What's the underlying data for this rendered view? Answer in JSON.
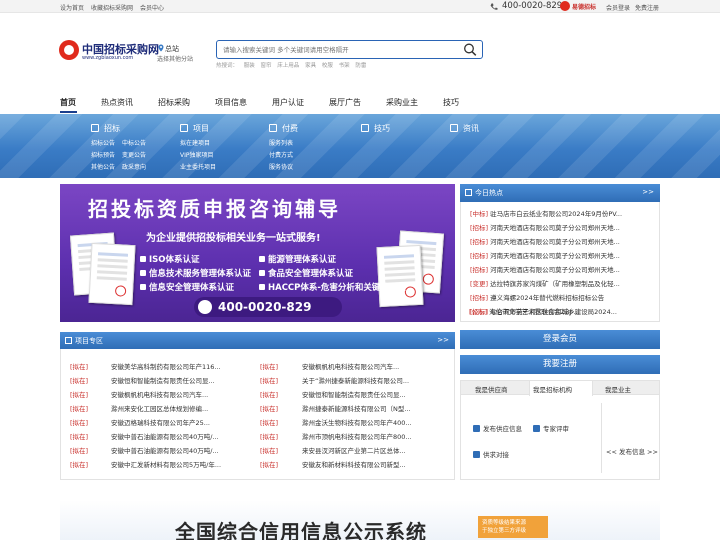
{
  "topbar": {
    "links": [
      "设为首页",
      "收藏招标采购网",
      "会员中心"
    ],
    "phone": "400-0020-829",
    "brand": "易德招标",
    "member_login": "会员登录",
    "free_register": "免费注册"
  },
  "header": {
    "logo_text": "中国招标采购网",
    "logo_url": "www.zgbiaoxun.com",
    "site_name": "总站",
    "site_switch": "选择其他分站",
    "search_placeholder": "请输入搜索关键词 多个关键词请用空格隔开",
    "hot_label": "热搜词：",
    "hot_words": [
      "服装",
      "窗帘",
      "床上用品",
      "家具",
      "校服",
      "书架",
      "防雷"
    ]
  },
  "nav": [
    "首页",
    "热点资讯",
    "招标采购",
    "项目信息",
    "用户认证",
    "展厅广告",
    "采购业主",
    "技巧"
  ],
  "band": [
    {
      "title": "招标",
      "links": [
        "招标公告",
        "中标公告",
        "招标预告",
        "变更公告",
        "其他公告",
        "政采意向"
      ]
    },
    {
      "title": "项目",
      "links": [
        "拟在建项目",
        "VIP独家项目",
        "业主委托项目"
      ]
    },
    {
      "title": "付费",
      "links": [
        "服务列表",
        "付费方式",
        "服务协议"
      ]
    },
    {
      "title": "技巧",
      "links": []
    },
    {
      "title": "资讯",
      "links": []
    }
  ],
  "banner": {
    "title": "招投标资质申报咨询辅导",
    "subtitle": "为企业提供招投标相关业务一站式服务!",
    "items": [
      "ISO体系认证",
      "能源管理体系认证",
      "信息技术服务管理体系认证",
      "食品安全管理体系认证",
      "信息安全管理体系认证",
      "HACCP体系-危害分析和关键控制点"
    ],
    "phone": "400-0020-829"
  },
  "hot_panel": {
    "title": "今日热点",
    "more": ">>",
    "rows": [
      {
        "tag": "[中标]",
        "text": "驻马店市白云纸业有限公司2024年9月份PV..."
      },
      {
        "tag": "[招标]",
        "text": "河南天地酒店有限公司莫子分公司郑州天地..."
      },
      {
        "tag": "[招标]",
        "text": "河南天地酒店有限公司莫子分公司郑州天地..."
      },
      {
        "tag": "[招标]",
        "text": "河南天地酒店有限公司莫子分公司郑州天地..."
      },
      {
        "tag": "[招标]",
        "text": "河南天地酒店有限公司莫子分公司郑州天地..."
      },
      {
        "tag": "[变更]",
        "text": "达拉特旗苏家沟煤矿（矿用橡塑制品及化轻..."
      },
      {
        "tag": "[招标]",
        "text": "遵义海螺2024年替代燃料招标招标公告"
      },
      {
        "tag": "[招标]",
        "text": "七台河市茄子河区住房和城乡建设局2024..."
      },
      {
        "tag": "[公示]",
        "text": "海伦市文学艺术界联合会ZBJ-..."
      }
    ]
  },
  "project_panel": {
    "title": "项目专区",
    "more": ">>",
    "left": [
      {
        "tag": "[拟在]",
        "text": "安徽美华高科制药有限公司年产116..."
      },
      {
        "tag": "[拟在]",
        "text": "安徽恒和智能制造有限责任公司显..."
      },
      {
        "tag": "[拟在]",
        "text": "安徽枫帆机电科技有限公司汽车..."
      },
      {
        "tag": "[拟在]",
        "text": "滁州来安化工园区总体规划修编..."
      },
      {
        "tag": "[拟在]",
        "text": "安徽迈格瑞科技有限公司年产25..."
      },
      {
        "tag": "[拟在]",
        "text": "安徽中普石油能源有限公司40万吨/..."
      },
      {
        "tag": "[拟在]",
        "text": "安徽中普石油能源有限公司40万吨/..."
      },
      {
        "tag": "[拟在]",
        "text": "安徽中汇发新材料有限公司5万吨/年..."
      }
    ],
    "right": [
      {
        "tag": "[拟在]",
        "text": "安徽枫帆机电科技有限公司汽车..."
      },
      {
        "tag": "[拟在]",
        "text": "关于“滁州捷泰新能源科技有限公司..."
      },
      {
        "tag": "[拟在]",
        "text": "安徽恒和智能制造有限责任公司显..."
      },
      {
        "tag": "[拟在]",
        "text": "滁州捷泰新能源科技有限公司（N型..."
      },
      {
        "tag": "[拟在]",
        "text": "滁州金沃生物科技有限公司年产400..."
      },
      {
        "tag": "[拟在]",
        "text": "滁州市顶帆电科技有限公司年产800..."
      },
      {
        "tag": "[拟在]",
        "text": "来安县汊河新区产业第二片区总体..."
      },
      {
        "tag": "[拟在]",
        "text": "安徽友和新材料科技有限公司新型..."
      }
    ]
  },
  "member": {
    "login": "登录会员",
    "register": "我要注册",
    "tabs": [
      "我是供应商",
      "我是招标机构",
      "我是业主"
    ],
    "links": [
      "发布供应信息",
      "专家评审",
      "供求对接"
    ],
    "publish": "<< 发布信息 >>"
  },
  "bottom_banner": {
    "title": "全国综合信用信息公示系统",
    "badge_lines": [
      "资质等级结果来源",
      "于独立第三方评级"
    ]
  }
}
